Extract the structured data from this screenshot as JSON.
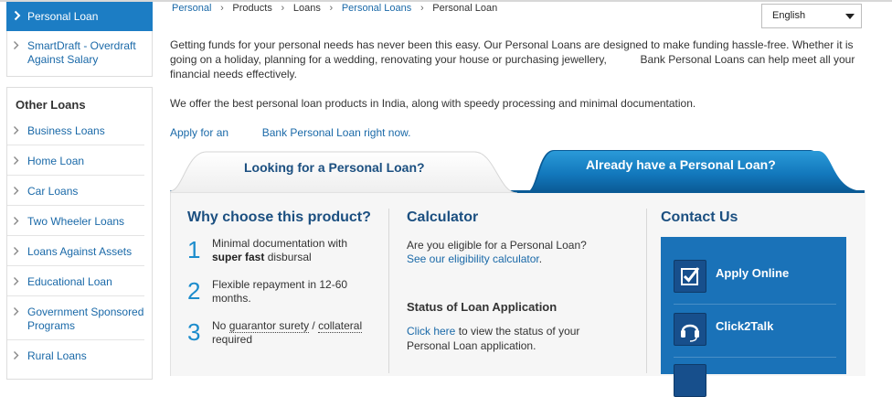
{
  "sidebar": {
    "active_item": "Personal Loan",
    "sub_item": "SmartDraft - Overdraft Against Salary",
    "other_loans_title": "Other Loans",
    "other_loans": [
      "Business Loans",
      "Home Loan",
      "Car Loans",
      "Two Wheeler Loans",
      "Loans Against Assets",
      "Educational Loan",
      "Government Sponsored Programs",
      "Rural Loans"
    ]
  },
  "breadcrumb": [
    "Personal",
    "Products",
    "Loans",
    "Personal Loans",
    "Personal Loan"
  ],
  "language": {
    "selected": "English"
  },
  "intro": {
    "paragraph1": "Getting funds for your personal needs has never been this easy. Our Personal Loans are designed to make funding hassle-free. Whether it is going on a holiday, planning for a wedding, renovating your house or purchasing jewellery,           Bank Personal Loans can help meet all your financial needs effectively.",
    "paragraph2": "We offer the best personal loan products in India, along with speedy processing and minimal documentation.",
    "apply_link": "Apply for an           Bank Personal Loan right now."
  },
  "tabs": {
    "left": "Looking for a Personal Loan?",
    "right": "Already have a Personal Loan?"
  },
  "why": {
    "title": "Why choose this product?",
    "items": [
      {
        "num": "1",
        "text_before": "Minimal documentation with ",
        "bold": "super fast",
        "text_after": " disbursal"
      },
      {
        "num": "2",
        "text": "Flexible repayment in 12-60 months."
      },
      {
        "num": "3",
        "pre": "No ",
        "w1": "guarantor surety",
        "mid": " / ",
        "w2": "collateral",
        "post": " required"
      }
    ]
  },
  "calculator": {
    "title": "Calculator",
    "question": "Are you eligible for a Personal Loan?",
    "link": "See our eligibility calculator",
    "link_suffix": ".",
    "status_title": "Status of Loan Application",
    "status_link": "Click here",
    "status_text": " to view the status of your Personal Loan application."
  },
  "contact": {
    "title": "Contact Us",
    "items": [
      {
        "label": "Apply Online",
        "icon": "checkbox-icon"
      },
      {
        "label": "Click2Talk",
        "icon": "headset-icon"
      }
    ]
  },
  "colors": {
    "accent_blue": "#1c7dc4",
    "link_blue": "#1a69a8",
    "heading_navy": "#1b4f80",
    "contact_blue": "#1a72b8"
  }
}
